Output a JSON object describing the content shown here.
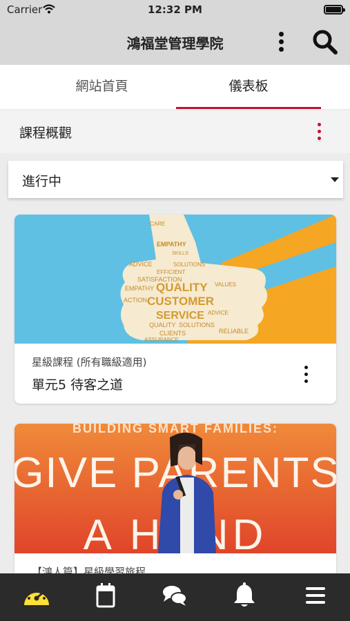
{
  "status_bar": {
    "carrier": "Carrier",
    "time": "12:32 PM"
  },
  "app_bar": {
    "title": "鴻福堂管理學院",
    "more_icon": "more-vertical-icon",
    "search_icon": "search-icon"
  },
  "tabs": [
    {
      "label": "網站首頁",
      "selected": false
    },
    {
      "label": "儀表板",
      "selected": true
    }
  ],
  "section": {
    "title": "課程概觀",
    "menu_icon": "more-vertical-icon"
  },
  "filter": {
    "selected": "進行中"
  },
  "courses": [
    {
      "category": "星級課程 (所有職級適用)",
      "title": "單元5 待客之道",
      "image_words": [
        "CARE",
        "EMPATHY",
        "ASSURANCE",
        "ADVICE",
        "SOLUTIONS",
        "EFFICIENT",
        "VALUES",
        "SATISFACTION",
        "QUALITY",
        "CUSTOMER",
        "SERVICE",
        "CLIENTS",
        "SKILLS",
        "RELIABLE",
        "ACTION"
      ]
    },
    {
      "category": "【鴻人篇】星級學習旅程",
      "title": "",
      "image_words": [
        "BUILDING SMART FAMILIES:",
        "GIVE PARENTS",
        "A HAND"
      ]
    }
  ],
  "colors": {
    "accent": "#c8102e",
    "appbar_bg": "#d8d8d8",
    "nav_bg": "#2b2b2b",
    "nav_active": "#ffe033",
    "nav_icon": "#ffffff"
  },
  "bottom_nav": [
    {
      "icon": "dashboard-icon",
      "active": true
    },
    {
      "icon": "calendar-icon",
      "active": false
    },
    {
      "icon": "chat-icon",
      "active": false
    },
    {
      "icon": "bell-icon",
      "active": false
    },
    {
      "icon": "menu-icon",
      "active": false
    }
  ]
}
